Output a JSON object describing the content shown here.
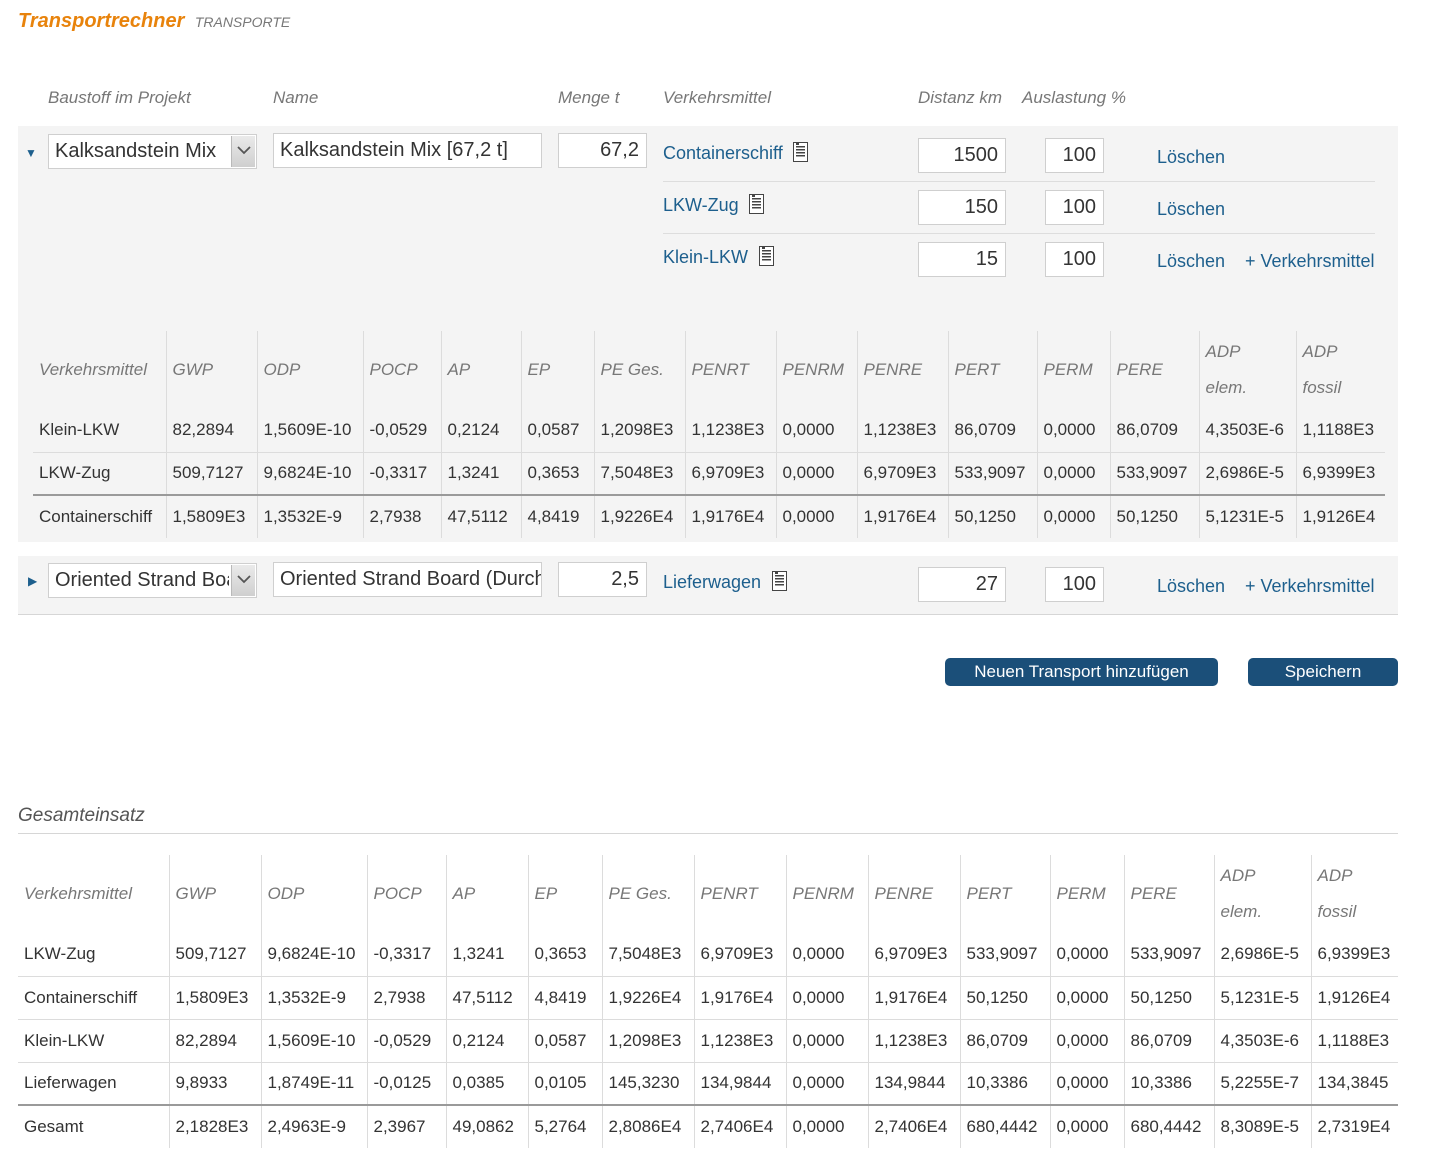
{
  "page": {
    "title": "Transportrechner",
    "subtitle": "TRANSPORTE"
  },
  "headers": {
    "baustoff": "Baustoff im Projekt",
    "name": "Name",
    "menge": "Menge t",
    "verkehrsmittel": "Verkehrsmittel",
    "distanz": "Distanz km",
    "auslastung": "Auslastung %"
  },
  "transports": [
    {
      "baustoff": "Kalksandstein Mix",
      "name": "Kalksandstein Mix [67,2 t]",
      "menge": "67,2",
      "modes": [
        {
          "label": "Containerschiff",
          "distanz": "1500",
          "auslastung": "100",
          "delete": "Löschen"
        },
        {
          "label": "LKW-Zug",
          "distanz": "150",
          "auslastung": "100",
          "delete": "Löschen"
        },
        {
          "label": "Klein-LKW",
          "distanz": "15",
          "auslastung": "100",
          "delete": "Löschen"
        }
      ],
      "add_mode": "+ Verkehrsmittel",
      "results": {
        "columns": [
          "Verkehrsmittel",
          "GWP",
          "ODP",
          "POCP",
          "AP",
          "EP",
          "PE Ges.",
          "PENRT",
          "PENRM",
          "PENRE",
          "PERT",
          "PERM",
          "PERE",
          [
            "ADP",
            "elem."
          ],
          [
            "ADP",
            "fossil"
          ]
        ],
        "rows": [
          [
            "Klein-LKW",
            "82,2894",
            "1,5609E-10",
            "-0,0529",
            "0,2124",
            "0,0587",
            "1,2098E3",
            "1,1238E3",
            "0,0000",
            "1,1238E3",
            "86,0709",
            "0,0000",
            "86,0709",
            "4,3503E-6",
            "1,1188E3"
          ],
          [
            "LKW-Zug",
            "509,7127",
            "9,6824E-10",
            "-0,3317",
            "1,3241",
            "0,3653",
            "7,5048E3",
            "6,9709E3",
            "0,0000",
            "6,9709E3",
            "533,9097",
            "0,0000",
            "533,9097",
            "2,6986E-5",
            "6,9399E3"
          ],
          [
            "Containerschiff",
            "1,5809E3",
            "1,3532E-9",
            "2,7938",
            "47,5112",
            "4,8419",
            "1,9226E4",
            "1,9176E4",
            "0,0000",
            "1,9176E4",
            "50,1250",
            "0,0000",
            "50,1250",
            "5,1231E-5",
            "1,9126E4"
          ]
        ]
      }
    },
    {
      "baustoff": "Oriented Strand Board (Durchschnitt DE)",
      "name": "Oriented Strand Board (Durchschnitt DE)",
      "menge": "2,5",
      "modes": [
        {
          "label": "Lieferwagen",
          "distanz": "27",
          "auslastung": "100",
          "delete": "Löschen"
        }
      ],
      "add_mode": "+ Verkehrsmittel"
    }
  ],
  "actions": {
    "add_transport": "Neuen Transport hinzufügen",
    "save": "Speichern"
  },
  "gesamt": {
    "title": "Gesamteinsatz",
    "columns": [
      "Verkehrsmittel",
      "GWP",
      "ODP",
      "POCP",
      "AP",
      "EP",
      "PE Ges.",
      "PENRT",
      "PENRM",
      "PENRE",
      "PERT",
      "PERM",
      "PERE",
      [
        "ADP",
        "elem."
      ],
      [
        "ADP",
        "fossil"
      ]
    ],
    "rows": [
      [
        "LKW-Zug",
        "509,7127",
        "9,6824E-10",
        "-0,3317",
        "1,3241",
        "0,3653",
        "7,5048E3",
        "6,9709E3",
        "0,0000",
        "6,9709E3",
        "533,9097",
        "0,0000",
        "533,9097",
        "2,6986E-5",
        "6,9399E3"
      ],
      [
        "Containerschiff",
        "1,5809E3",
        "1,3532E-9",
        "2,7938",
        "47,5112",
        "4,8419",
        "1,9226E4",
        "1,9176E4",
        "0,0000",
        "1,9176E4",
        "50,1250",
        "0,0000",
        "50,1250",
        "5,1231E-5",
        "1,9126E4"
      ],
      [
        "Klein-LKW",
        "82,2894",
        "1,5609E-10",
        "-0,0529",
        "0,2124",
        "0,0587",
        "1,2098E3",
        "1,1238E3",
        "0,0000",
        "1,1238E3",
        "86,0709",
        "0,0000",
        "86,0709",
        "4,3503E-6",
        "1,1188E3"
      ],
      [
        "Lieferwagen",
        "9,8933",
        "1,8749E-11",
        "-0,0125",
        "0,0385",
        "0,0105",
        "145,3230",
        "134,9844",
        "0,0000",
        "134,9844",
        "10,3386",
        "0,0000",
        "10,3386",
        "5,2255E-7",
        "134,3845"
      ]
    ],
    "total": [
      "Gesamt",
      "2,1828E3",
      "2,4963E-9",
      "2,3967",
      "49,0862",
      "5,2764",
      "2,8086E4",
      "2,7406E4",
      "0,0000",
      "2,7406E4",
      "680,4442",
      "0,0000",
      "680,4442",
      "8,3089E-5",
      "2,7319E4"
    ]
  }
}
